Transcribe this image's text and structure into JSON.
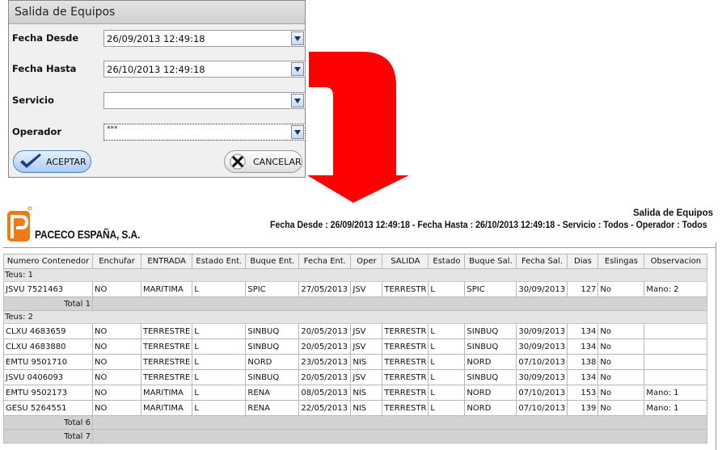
{
  "dialog": {
    "title": "Salida de Equipos",
    "fields": [
      {
        "label": "Fecha Desde",
        "value": "26/09/2013 12:49:18"
      },
      {
        "label": "Fecha Hasta",
        "value": "26/10/2013 12:49:18"
      },
      {
        "label": "Servicio",
        "value": ""
      },
      {
        "label": "Operador",
        "value": "***"
      }
    ],
    "accept_label": "ACEPTAR",
    "cancel_label": "CANCELAR"
  },
  "colors": {
    "arrow": "#ff0000",
    "accept_check": "#1f3d8a"
  },
  "report": {
    "company": "PACECO ESPAÑA, S.A.",
    "title": "Salida de Equipos",
    "subtitle": "Fecha Desde : 26/09/2013 12:49:18 - Fecha Hasta : 26/10/2013 12:49:18 - Servicio : Todos - Operador : Todos",
    "columns": [
      "Numero Contenedor",
      "Enchufar",
      "ENTRADA",
      "Estado Ent.",
      "Buque Ent.",
      "Fecha Ent.",
      "Oper",
      "SALIDA",
      "Estado",
      "Buque Sal.",
      "Fecha Sal.",
      "Dias",
      "Eslingas",
      "Observacion"
    ],
    "groups": [
      {
        "label": "Teus: 1",
        "rows": [
          [
            "JSVU 7521463",
            "NO",
            "MARITIMA",
            "L",
            "SPIC",
            "27/05/2013",
            "JSV",
            "TERRESTR",
            "L",
            "SPIC",
            "30/09/2013",
            "127",
            "No",
            "Mano: 2"
          ]
        ],
        "total": "Total 1"
      },
      {
        "label": "Teus: 2",
        "rows": [
          [
            "CLXU 4683659",
            "NO",
            "TERRESTRE",
            "L",
            "SINBUQ",
            "20/05/2013",
            "JSV",
            "TERRESTR",
            "L",
            "SINBUQ",
            "30/09/2013",
            "134",
            "No",
            ""
          ],
          [
            "CLXU 4683880",
            "NO",
            "TERRESTRE",
            "L",
            "SINBUQ",
            "20/05/2013",
            "JSV",
            "TERRESTR",
            "L",
            "SINBUQ",
            "30/09/2013",
            "134",
            "No",
            ""
          ],
          [
            "EMTU 9501710",
            "NO",
            "TERRESTRE",
            "L",
            "NORD",
            "23/05/2013",
            "NIS",
            "TERRESTR",
            "L",
            "NORD",
            "07/10/2013",
            "138",
            "No",
            ""
          ],
          [
            "JSVU 0406093",
            "NO",
            "TERRESTRE",
            "L",
            "SINBUQ",
            "20/05/2013",
            "JSV",
            "TERRESTR",
            "L",
            "SINBUQ",
            "30/09/2013",
            "134",
            "No",
            ""
          ],
          [
            "EMTU 9502173",
            "NO",
            "MARITIMA",
            "L",
            "RENA",
            "08/05/2013",
            "NIS",
            "TERRESTR",
            "L",
            "NORD",
            "07/10/2013",
            "153",
            "No",
            "Mano: 1"
          ],
          [
            "GESU 5264551",
            "NO",
            "MARITIMA",
            "L",
            "RENA",
            "22/05/2013",
            "NIS",
            "TERRESTR",
            "L",
            "NORD",
            "07/10/2013",
            "139",
            "No",
            "Mano: 1"
          ]
        ],
        "total": "Total 6"
      }
    ],
    "grand_total": "Total 7"
  }
}
